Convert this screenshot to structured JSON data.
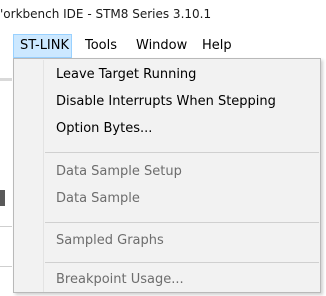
{
  "window": {
    "title": "'orkbench IDE - STM8 Series 3.10.1"
  },
  "menubar": {
    "items": [
      {
        "label": "ST-LINK",
        "active": true
      },
      {
        "label": "Tools"
      },
      {
        "label": "Window"
      },
      {
        "label": "Help"
      }
    ]
  },
  "dropdown": {
    "items": [
      {
        "label": "Leave Target Running",
        "enabled": true
      },
      {
        "label": "Disable Interrupts When Stepping",
        "enabled": true
      },
      {
        "label": "Option Bytes...",
        "enabled": true
      },
      {
        "label": "Data Sample Setup",
        "enabled": false
      },
      {
        "label": "Data Sample",
        "enabled": false
      },
      {
        "label": "Sampled Graphs",
        "enabled": false
      },
      {
        "label": "Breakpoint Usage...",
        "enabled": false
      }
    ]
  },
  "colors": {
    "menu_active_bg": "#cce8ff",
    "menu_active_border": "#99d1ff",
    "dropdown_bg": "#f2f2f2",
    "disabled_text": "#6d6d6d"
  }
}
